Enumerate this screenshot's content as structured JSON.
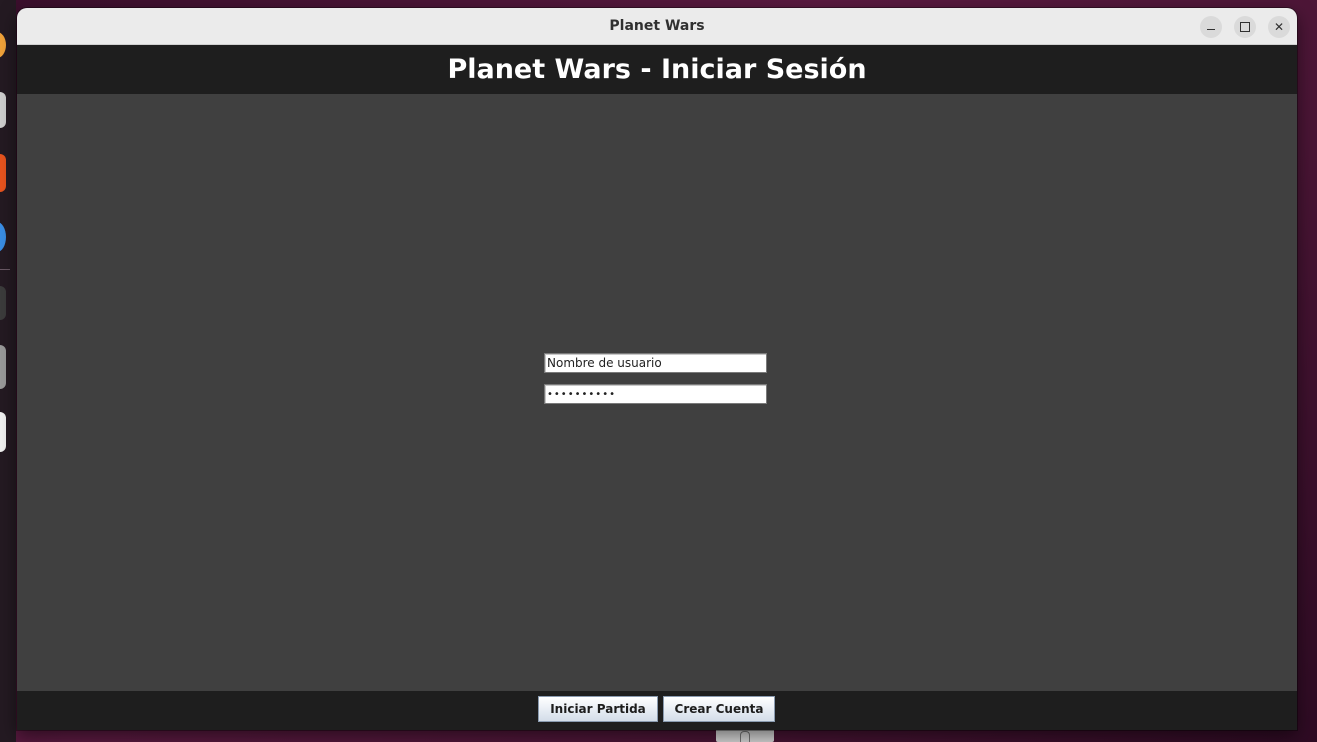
{
  "window": {
    "title": "Planet Wars"
  },
  "header": {
    "title": "Planet Wars - Iniciar Sesión"
  },
  "login": {
    "username_value": "Nombre de usuario",
    "password_mask": "••••••••••"
  },
  "footer": {
    "start_label": "Iniciar Partida",
    "create_label": "Crear Cuenta"
  },
  "icons": {
    "minimize": "minimize-icon",
    "maximize": "maximize-icon",
    "close": "close-icon"
  },
  "colors": {
    "header_bg": "#1e1e1e",
    "content_bg": "#404040",
    "titlebar_bg": "#ebebeb"
  }
}
